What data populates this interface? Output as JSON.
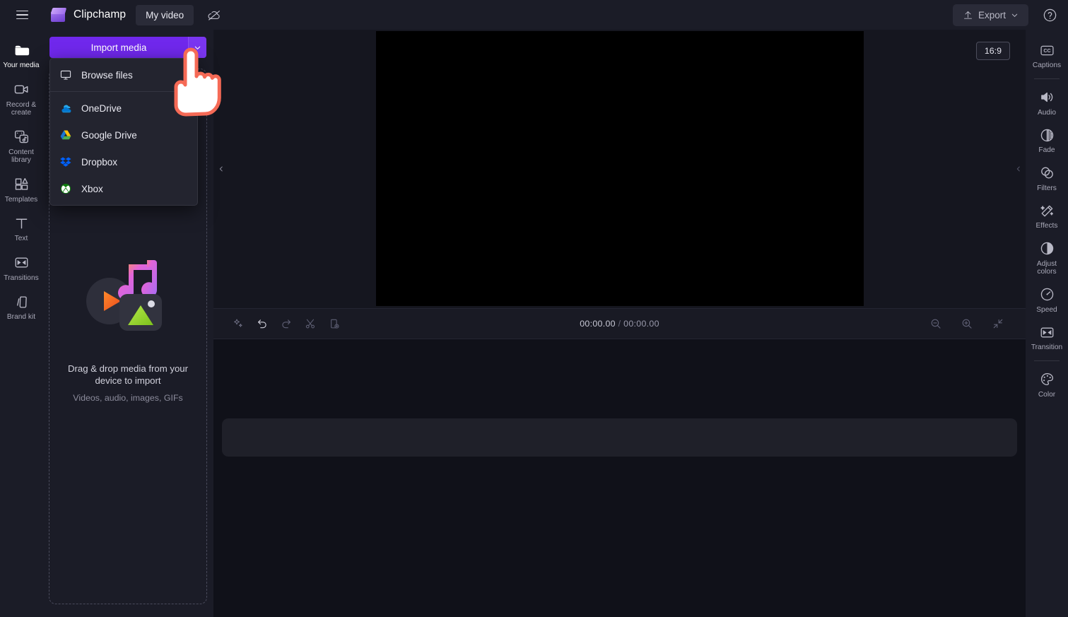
{
  "topbar": {
    "menu_icon": "hamburger-icon",
    "brand": "Clipchamp",
    "project_name": "My video",
    "cloud_icon": "cloud-off-icon",
    "export_label": "Export",
    "export_icon": "upload-icon",
    "export_caret": "chevron-down-icon",
    "help_icon": "help-circle-icon"
  },
  "left_rail": {
    "items": [
      {
        "label": "Your media",
        "icon": "folder-icon",
        "active": true
      },
      {
        "label": "Record & create",
        "icon": "video-camera-icon",
        "active": false
      },
      {
        "label": "Content library",
        "icon": "content-library-icon",
        "active": false
      },
      {
        "label": "Templates",
        "icon": "templates-icon",
        "active": false
      },
      {
        "label": "Text",
        "icon": "text-icon",
        "active": false
      },
      {
        "label": "Transitions",
        "icon": "transitions-icon",
        "active": false
      },
      {
        "label": "Brand kit",
        "icon": "brand-kit-icon",
        "active": false
      }
    ]
  },
  "media_panel": {
    "import_label": "Import media",
    "import_caret_icon": "chevron-down-icon",
    "menu": {
      "open": true,
      "items": [
        {
          "label": "Browse files",
          "icon": "monitor-icon"
        },
        {
          "label": "OneDrive",
          "icon": "onedrive-icon"
        },
        {
          "label": "Google Drive",
          "icon": "google-drive-icon"
        },
        {
          "label": "Dropbox",
          "icon": "dropbox-icon"
        },
        {
          "label": "Xbox",
          "icon": "xbox-icon"
        }
      ]
    },
    "dropzone": {
      "art_icon": "media-stack-icon",
      "primary_text": "Drag & drop media from your device to import",
      "secondary_text": "Videos, audio, images, GIFs"
    }
  },
  "stage": {
    "aspect_ratio": "16:9",
    "collapse_left_icon": "chevron-left-icon",
    "collapse_right_icon": "chevron-left-icon"
  },
  "timeline": {
    "tools": [
      {
        "name": "magic-wand-icon",
        "label": "Auto compose"
      },
      {
        "name": "undo-icon",
        "label": "Undo"
      },
      {
        "name": "redo-icon",
        "label": "Redo"
      },
      {
        "name": "scissors-icon",
        "label": "Split"
      },
      {
        "name": "add-clip-icon",
        "label": "Add clip"
      }
    ],
    "current_time": "00:00.00",
    "time_separator": "/",
    "total_time": "00:00.00",
    "zoom_out_icon": "zoom-out-icon",
    "zoom_in_icon": "zoom-in-icon",
    "fit_icon": "fit-to-screen-icon"
  },
  "right_rail": {
    "items": [
      {
        "label": "Captions",
        "icon": "captions-icon",
        "sep_after": true
      },
      {
        "label": "Audio",
        "icon": "speaker-icon",
        "sep_after": false
      },
      {
        "label": "Fade",
        "icon": "fade-icon",
        "sep_after": false
      },
      {
        "label": "Filters",
        "icon": "filters-icon",
        "sep_after": false
      },
      {
        "label": "Effects",
        "icon": "effects-icon",
        "sep_after": false
      },
      {
        "label": "Adjust colors",
        "icon": "adjust-colors-icon",
        "sep_after": false
      },
      {
        "label": "Speed",
        "icon": "speed-icon",
        "sep_after": false
      },
      {
        "label": "Transition",
        "icon": "transition-icon",
        "sep_after": true
      },
      {
        "label": "Color",
        "icon": "color-palette-icon",
        "sep_after": false
      }
    ]
  },
  "cursor": {
    "icon": "pointing-hand-cursor"
  },
  "colors": {
    "accent": "#7028ec",
    "topbar_bg": "#1b1c27",
    "panel_bg": "#1b1c27",
    "stage_bg": "#15161f",
    "timeline_bg": "#101119",
    "cursor_outline": "#f56a56"
  }
}
